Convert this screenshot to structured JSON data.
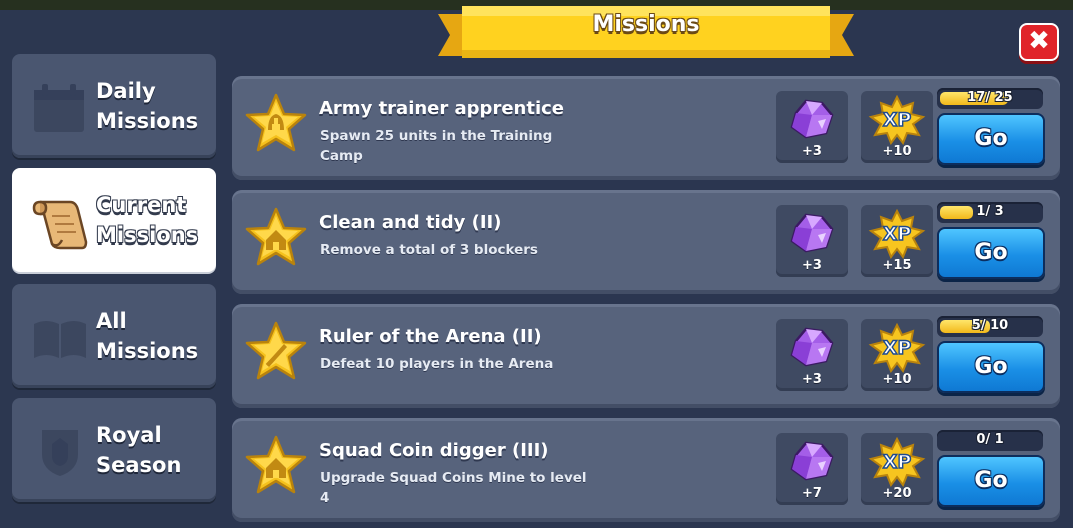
{
  "header": {
    "title": "Missions",
    "close_label": "✖"
  },
  "sidebar": {
    "tabs": [
      {
        "label": "Daily\nMissions",
        "icon": "calendar-icon",
        "active": false
      },
      {
        "label": "Current\nMissions",
        "icon": "scroll-icon",
        "active": true
      },
      {
        "label": "All\nMissions",
        "icon": "book-icon",
        "active": false
      },
      {
        "label": "Royal\nSeason",
        "icon": "crest-icon",
        "active": false
      }
    ]
  },
  "missions": [
    {
      "title": "Army trainer apprentice",
      "description": "Spawn 25 units in the Training Camp",
      "icon": "helmet-star-icon",
      "gems": "+3",
      "xp": "+10",
      "progress_text": "17/ 25",
      "progress_fraction": 0.68,
      "button": "Go"
    },
    {
      "title": "Clean and tidy   (II)",
      "description": "Remove a total of 3 blockers",
      "icon": "house-star-icon",
      "gems": "+3",
      "xp": "+15",
      "progress_text": "1/ 3",
      "progress_fraction": 0.333,
      "button": "Go"
    },
    {
      "title": "Ruler of the Arena  (II)",
      "description": "Defeat 10 players in the Arena",
      "icon": "sword-star-icon",
      "gems": "+3",
      "xp": "+10",
      "progress_text": "5/ 10",
      "progress_fraction": 0.5,
      "button": "Go"
    },
    {
      "title": "Squad Coin digger  (III)",
      "description": "Upgrade Squad Coins Mine to level 4",
      "icon": "house-star-icon",
      "gems": "+7",
      "xp": "+20",
      "progress_text": "0/ 1",
      "progress_fraction": 0,
      "button": "Go"
    }
  ],
  "xp_badge_label": "XP",
  "colors": {
    "accent_yellow": "#ffd21f",
    "button_blue": "#1a8fe6",
    "close_red": "#e0242a",
    "gem_purple": "#a45ee8"
  }
}
